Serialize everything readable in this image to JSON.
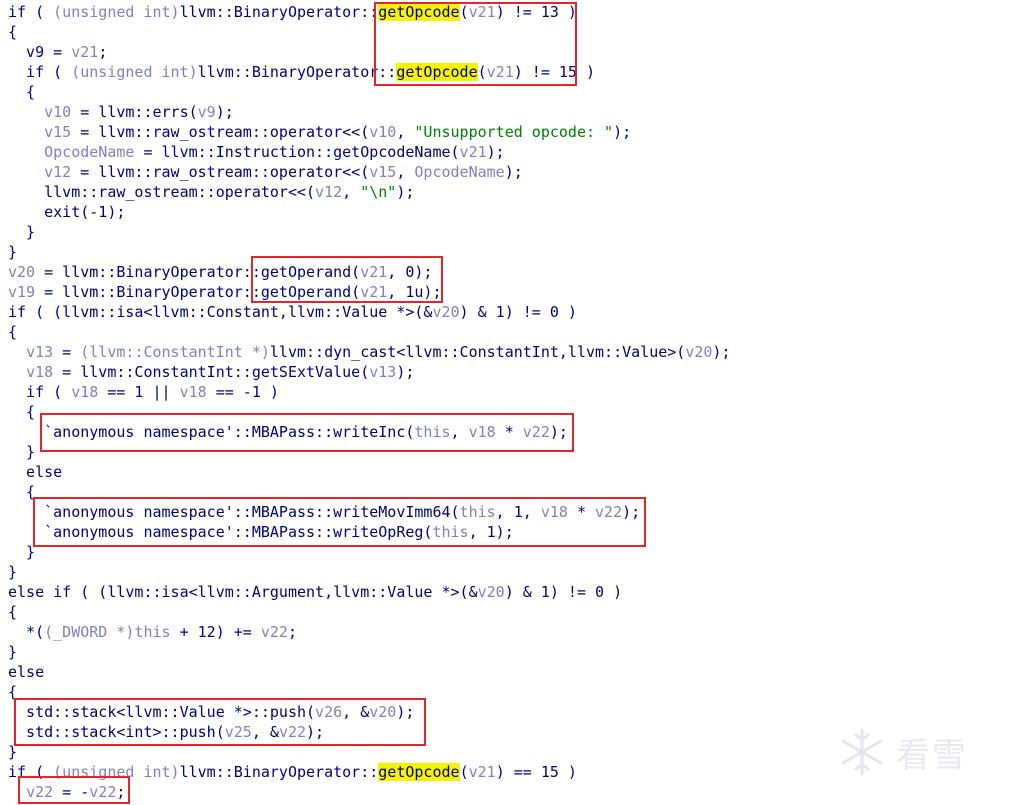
{
  "code_lines": [
    [
      {
        "t": "if ( ",
        "c": "default"
      },
      {
        "t": "(unsigned int)",
        "c": "var"
      },
      {
        "t": "llvm::BinaryOperator::",
        "c": "default"
      },
      {
        "t": "getOpcode",
        "c": "hl"
      },
      {
        "t": "(",
        "c": "default"
      },
      {
        "t": "v21",
        "c": "var"
      },
      {
        "t": ") != 13 )",
        "c": "default"
      }
    ],
    [
      {
        "t": "{",
        "c": "default"
      }
    ],
    [
      {
        "t": "  v9 = ",
        "c": "default"
      },
      {
        "t": "v21",
        "c": "var"
      },
      {
        "t": ";",
        "c": "default"
      }
    ],
    [
      {
        "t": "  if ( ",
        "c": "default"
      },
      {
        "t": "(unsigned int)",
        "c": "var"
      },
      {
        "t": "llvm::BinaryOperator::",
        "c": "default"
      },
      {
        "t": "getOpcode",
        "c": "hl"
      },
      {
        "t": "(",
        "c": "default"
      },
      {
        "t": "v21",
        "c": "var"
      },
      {
        "t": ") != 15 )",
        "c": "default"
      }
    ],
    [
      {
        "t": "  {",
        "c": "default"
      }
    ],
    [
      {
        "t": "    ",
        "c": "default"
      },
      {
        "t": "v10",
        "c": "var"
      },
      {
        "t": " = llvm::errs(",
        "c": "default"
      },
      {
        "t": "v9",
        "c": "var"
      },
      {
        "t": ");",
        "c": "default"
      }
    ],
    [
      {
        "t": "    ",
        "c": "default"
      },
      {
        "t": "v15",
        "c": "var"
      },
      {
        "t": " = llvm::raw_ostream::operator<<(",
        "c": "default"
      },
      {
        "t": "v10",
        "c": "var"
      },
      {
        "t": ", ",
        "c": "default"
      },
      {
        "t": "\"Unsupported opcode: \"",
        "c": "string"
      },
      {
        "t": ");",
        "c": "default"
      }
    ],
    [
      {
        "t": "    ",
        "c": "default"
      },
      {
        "t": "OpcodeName",
        "c": "var"
      },
      {
        "t": " = llvm::Instruction::getOpcodeName(",
        "c": "default"
      },
      {
        "t": "v21",
        "c": "var"
      },
      {
        "t": ");",
        "c": "default"
      }
    ],
    [
      {
        "t": "    ",
        "c": "default"
      },
      {
        "t": "v12",
        "c": "var"
      },
      {
        "t": " = llvm::raw_ostream::operator<<(",
        "c": "default"
      },
      {
        "t": "v15",
        "c": "var"
      },
      {
        "t": ", ",
        "c": "default"
      },
      {
        "t": "OpcodeName",
        "c": "var"
      },
      {
        "t": ");",
        "c": "default"
      }
    ],
    [
      {
        "t": "    llvm::raw_ostream::operator<<(",
        "c": "default"
      },
      {
        "t": "v12",
        "c": "var"
      },
      {
        "t": ", ",
        "c": "default"
      },
      {
        "t": "\"\\n\"",
        "c": "string"
      },
      {
        "t": ");",
        "c": "default"
      }
    ],
    [
      {
        "t": "    exit(-1);",
        "c": "default"
      }
    ],
    [
      {
        "t": "  }",
        "c": "default"
      }
    ],
    [
      {
        "t": "}",
        "c": "default"
      }
    ],
    [
      {
        "t": "v20",
        "c": "var"
      },
      {
        "t": " = llvm::BinaryOperator::getOperand(",
        "c": "default"
      },
      {
        "t": "v21",
        "c": "var"
      },
      {
        "t": ", 0);",
        "c": "default"
      }
    ],
    [
      {
        "t": "v19",
        "c": "var"
      },
      {
        "t": " = llvm::BinaryOperator::getOperand(",
        "c": "default"
      },
      {
        "t": "v21",
        "c": "var"
      },
      {
        "t": ", 1u);",
        "c": "default"
      }
    ],
    [
      {
        "t": "if ( (llvm::isa<llvm::Constant,llvm::Value *>(&",
        "c": "default"
      },
      {
        "t": "v20",
        "c": "var"
      },
      {
        "t": ") & 1) != 0 )",
        "c": "default"
      }
    ],
    [
      {
        "t": "{",
        "c": "default"
      }
    ],
    [
      {
        "t": "  ",
        "c": "default"
      },
      {
        "t": "v13",
        "c": "var"
      },
      {
        "t": " = ",
        "c": "default"
      },
      {
        "t": "(llvm::ConstantInt *)",
        "c": "var"
      },
      {
        "t": "llvm::dyn_cast<llvm::ConstantInt,llvm::Value>(",
        "c": "default"
      },
      {
        "t": "v20",
        "c": "var"
      },
      {
        "t": ");",
        "c": "default"
      }
    ],
    [
      {
        "t": "  ",
        "c": "default"
      },
      {
        "t": "v18",
        "c": "var"
      },
      {
        "t": " = llvm::ConstantInt::getSExtValue(",
        "c": "default"
      },
      {
        "t": "v13",
        "c": "var"
      },
      {
        "t": ");",
        "c": "default"
      }
    ],
    [
      {
        "t": "  if ( ",
        "c": "default"
      },
      {
        "t": "v18",
        "c": "var"
      },
      {
        "t": " == 1 || ",
        "c": "default"
      },
      {
        "t": "v18",
        "c": "var"
      },
      {
        "t": " == -1 )",
        "c": "default"
      }
    ],
    [
      {
        "t": "  {",
        "c": "default"
      }
    ],
    [
      {
        "t": "    `anonymous namespace'::MBAPass::writeInc(",
        "c": "default"
      },
      {
        "t": "this",
        "c": "var"
      },
      {
        "t": ", ",
        "c": "default"
      },
      {
        "t": "v18",
        "c": "var"
      },
      {
        "t": " * ",
        "c": "default"
      },
      {
        "t": "v22",
        "c": "var"
      },
      {
        "t": ");",
        "c": "default"
      }
    ],
    [
      {
        "t": "  }",
        "c": "default"
      }
    ],
    [
      {
        "t": "  else",
        "c": "default"
      }
    ],
    [
      {
        "t": "  {",
        "c": "default"
      }
    ],
    [
      {
        "t": "    `anonymous namespace'::MBAPass::writeMovImm64(",
        "c": "default"
      },
      {
        "t": "this",
        "c": "var"
      },
      {
        "t": ", 1, ",
        "c": "default"
      },
      {
        "t": "v18",
        "c": "var"
      },
      {
        "t": " * ",
        "c": "default"
      },
      {
        "t": "v22",
        "c": "var"
      },
      {
        "t": ");",
        "c": "default"
      }
    ],
    [
      {
        "t": "    `anonymous namespace'::MBAPass::writeOpReg(",
        "c": "default"
      },
      {
        "t": "this",
        "c": "var"
      },
      {
        "t": ", 1);",
        "c": "default"
      }
    ],
    [
      {
        "t": "  }",
        "c": "default"
      }
    ],
    [
      {
        "t": "}",
        "c": "default"
      }
    ],
    [
      {
        "t": "else if ( (llvm::isa<llvm::Argument,llvm::Value *>(&",
        "c": "default"
      },
      {
        "t": "v20",
        "c": "var"
      },
      {
        "t": ") & 1) != 0 )",
        "c": "default"
      }
    ],
    [
      {
        "t": "{",
        "c": "default"
      }
    ],
    [
      {
        "t": "  *(",
        "c": "default"
      },
      {
        "t": "(_DWORD *)",
        "c": "var"
      },
      {
        "t": "this",
        "c": "var"
      },
      {
        "t": " + 12) += ",
        "c": "default"
      },
      {
        "t": "v22",
        "c": "var"
      },
      {
        "t": ";",
        "c": "default"
      }
    ],
    [
      {
        "t": "}",
        "c": "default"
      }
    ],
    [
      {
        "t": "else",
        "c": "default"
      }
    ],
    [
      {
        "t": "{",
        "c": "default"
      }
    ],
    [
      {
        "t": "  std::stack<llvm::Value *>::push(",
        "c": "default"
      },
      {
        "t": "v26",
        "c": "var"
      },
      {
        "t": ", &",
        "c": "default"
      },
      {
        "t": "v20",
        "c": "var"
      },
      {
        "t": ");",
        "c": "default"
      }
    ],
    [
      {
        "t": "  std::stack<int>::push(",
        "c": "default"
      },
      {
        "t": "v25",
        "c": "var"
      },
      {
        "t": ", &",
        "c": "default"
      },
      {
        "t": "v22",
        "c": "var"
      },
      {
        "t": ");",
        "c": "default"
      }
    ],
    [
      {
        "t": "}",
        "c": "default"
      }
    ],
    [
      {
        "t": "if ( ",
        "c": "default"
      },
      {
        "t": "(unsigned int)",
        "c": "var"
      },
      {
        "t": "llvm::BinaryOperator::",
        "c": "default"
      },
      {
        "t": "getOpcode",
        "c": "hl"
      },
      {
        "t": "(",
        "c": "default"
      },
      {
        "t": "v21",
        "c": "var"
      },
      {
        "t": ") == 15 )",
        "c": "default"
      }
    ],
    [
      {
        "t": "  ",
        "c": "default"
      },
      {
        "t": "v22",
        "c": "var"
      },
      {
        "t": " = -",
        "c": "default"
      },
      {
        "t": "v22",
        "c": "var"
      },
      {
        "t": ";",
        "c": "default"
      }
    ]
  ],
  "watermark": {
    "logo_icon": "snowflake-logo-icon",
    "text": "看雪"
  },
  "colors": {
    "default_text": "#000080",
    "variable_text": "#8080c0",
    "string_text": "#008000",
    "highlight_bg": "#f4f400",
    "annotation_border": "#e3262c"
  }
}
